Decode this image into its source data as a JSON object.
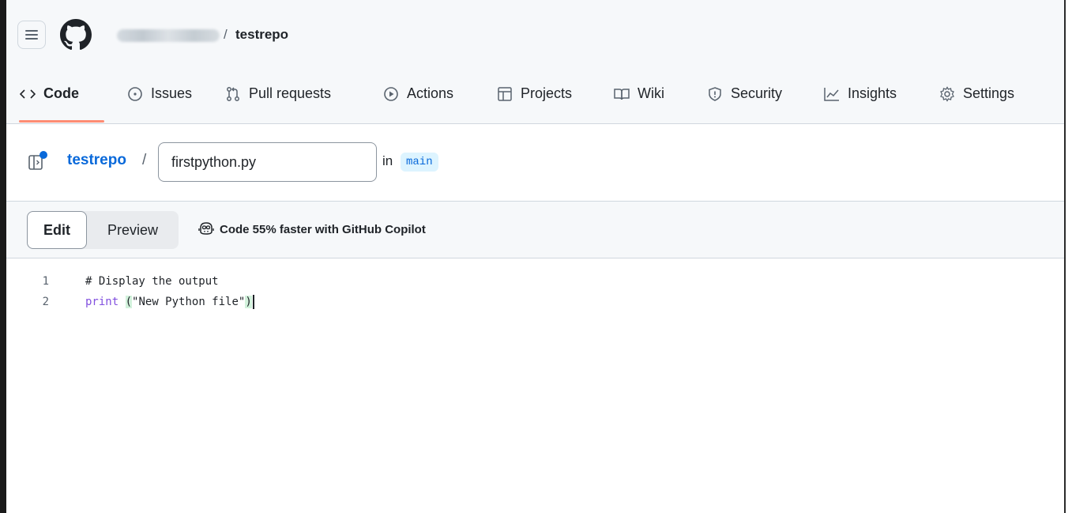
{
  "repo": {
    "name": "testrepo",
    "separator": "/"
  },
  "nav": {
    "tabs": [
      {
        "label": "Code",
        "icon": "code-icon",
        "active": true
      },
      {
        "label": "Issues",
        "icon": "issue-opened-icon"
      },
      {
        "label": "Pull requests",
        "icon": "git-pull-request-icon"
      },
      {
        "label": "Actions",
        "icon": "play-icon"
      },
      {
        "label": "Projects",
        "icon": "table-icon"
      },
      {
        "label": "Wiki",
        "icon": "book-icon"
      },
      {
        "label": "Security",
        "icon": "shield-icon"
      },
      {
        "label": "Insights",
        "icon": "graph-icon"
      },
      {
        "label": "Settings",
        "icon": "gear-icon"
      }
    ]
  },
  "file": {
    "repo_link": "testrepo",
    "separator": "/",
    "name": "firstpython.py",
    "in_label": "in",
    "branch": "main"
  },
  "editor": {
    "edit_label": "Edit",
    "preview_label": "Preview",
    "copilot_label": "Code 55% faster with GitHub Copilot",
    "lines": [
      {
        "number": "1",
        "text": "# Display the output"
      },
      {
        "number": "2",
        "keyword": "print",
        "space": " ",
        "open": "(",
        "string": "\"New Python file\"",
        "close": ")"
      }
    ]
  },
  "colors": {
    "accent": "#0969da",
    "tab_underline": "#fd8c73",
    "keyword": "#8250df",
    "branch_bg": "#ddf4ff"
  }
}
